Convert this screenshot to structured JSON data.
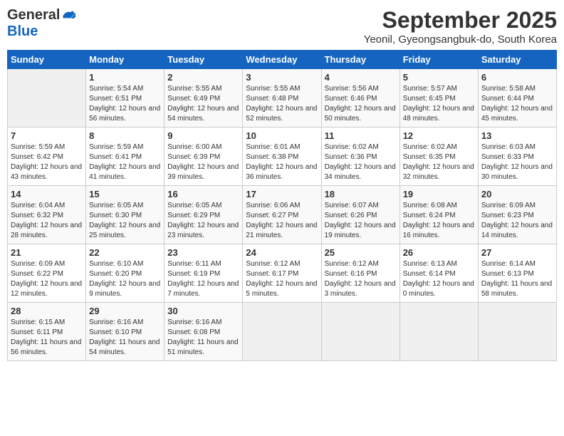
{
  "logo": {
    "general": "General",
    "blue": "Blue"
  },
  "title": "September 2025",
  "subtitle": "Yeonil, Gyeongsangbuk-do, South Korea",
  "days_of_week": [
    "Sunday",
    "Monday",
    "Tuesday",
    "Wednesday",
    "Thursday",
    "Friday",
    "Saturday"
  ],
  "weeks": [
    [
      {
        "day": "",
        "sunrise": "",
        "sunset": "",
        "daylight": ""
      },
      {
        "day": "1",
        "sunrise": "Sunrise: 5:54 AM",
        "sunset": "Sunset: 6:51 PM",
        "daylight": "Daylight: 12 hours and 56 minutes."
      },
      {
        "day": "2",
        "sunrise": "Sunrise: 5:55 AM",
        "sunset": "Sunset: 6:49 PM",
        "daylight": "Daylight: 12 hours and 54 minutes."
      },
      {
        "day": "3",
        "sunrise": "Sunrise: 5:55 AM",
        "sunset": "Sunset: 6:48 PM",
        "daylight": "Daylight: 12 hours and 52 minutes."
      },
      {
        "day": "4",
        "sunrise": "Sunrise: 5:56 AM",
        "sunset": "Sunset: 6:46 PM",
        "daylight": "Daylight: 12 hours and 50 minutes."
      },
      {
        "day": "5",
        "sunrise": "Sunrise: 5:57 AM",
        "sunset": "Sunset: 6:45 PM",
        "daylight": "Daylight: 12 hours and 48 minutes."
      },
      {
        "day": "6",
        "sunrise": "Sunrise: 5:58 AM",
        "sunset": "Sunset: 6:44 PM",
        "daylight": "Daylight: 12 hours and 45 minutes."
      }
    ],
    [
      {
        "day": "7",
        "sunrise": "Sunrise: 5:59 AM",
        "sunset": "Sunset: 6:42 PM",
        "daylight": "Daylight: 12 hours and 43 minutes."
      },
      {
        "day": "8",
        "sunrise": "Sunrise: 5:59 AM",
        "sunset": "Sunset: 6:41 PM",
        "daylight": "Daylight: 12 hours and 41 minutes."
      },
      {
        "day": "9",
        "sunrise": "Sunrise: 6:00 AM",
        "sunset": "Sunset: 6:39 PM",
        "daylight": "Daylight: 12 hours and 39 minutes."
      },
      {
        "day": "10",
        "sunrise": "Sunrise: 6:01 AM",
        "sunset": "Sunset: 6:38 PM",
        "daylight": "Daylight: 12 hours and 36 minutes."
      },
      {
        "day": "11",
        "sunrise": "Sunrise: 6:02 AM",
        "sunset": "Sunset: 6:36 PM",
        "daylight": "Daylight: 12 hours and 34 minutes."
      },
      {
        "day": "12",
        "sunrise": "Sunrise: 6:02 AM",
        "sunset": "Sunset: 6:35 PM",
        "daylight": "Daylight: 12 hours and 32 minutes."
      },
      {
        "day": "13",
        "sunrise": "Sunrise: 6:03 AM",
        "sunset": "Sunset: 6:33 PM",
        "daylight": "Daylight: 12 hours and 30 minutes."
      }
    ],
    [
      {
        "day": "14",
        "sunrise": "Sunrise: 6:04 AM",
        "sunset": "Sunset: 6:32 PM",
        "daylight": "Daylight: 12 hours and 28 minutes."
      },
      {
        "day": "15",
        "sunrise": "Sunrise: 6:05 AM",
        "sunset": "Sunset: 6:30 PM",
        "daylight": "Daylight: 12 hours and 25 minutes."
      },
      {
        "day": "16",
        "sunrise": "Sunrise: 6:05 AM",
        "sunset": "Sunset: 6:29 PM",
        "daylight": "Daylight: 12 hours and 23 minutes."
      },
      {
        "day": "17",
        "sunrise": "Sunrise: 6:06 AM",
        "sunset": "Sunset: 6:27 PM",
        "daylight": "Daylight: 12 hours and 21 minutes."
      },
      {
        "day": "18",
        "sunrise": "Sunrise: 6:07 AM",
        "sunset": "Sunset: 6:26 PM",
        "daylight": "Daylight: 12 hours and 19 minutes."
      },
      {
        "day": "19",
        "sunrise": "Sunrise: 6:08 AM",
        "sunset": "Sunset: 6:24 PM",
        "daylight": "Daylight: 12 hours and 16 minutes."
      },
      {
        "day": "20",
        "sunrise": "Sunrise: 6:09 AM",
        "sunset": "Sunset: 6:23 PM",
        "daylight": "Daylight: 12 hours and 14 minutes."
      }
    ],
    [
      {
        "day": "21",
        "sunrise": "Sunrise: 6:09 AM",
        "sunset": "Sunset: 6:22 PM",
        "daylight": "Daylight: 12 hours and 12 minutes."
      },
      {
        "day": "22",
        "sunrise": "Sunrise: 6:10 AM",
        "sunset": "Sunset: 6:20 PM",
        "daylight": "Daylight: 12 hours and 9 minutes."
      },
      {
        "day": "23",
        "sunrise": "Sunrise: 6:11 AM",
        "sunset": "Sunset: 6:19 PM",
        "daylight": "Daylight: 12 hours and 7 minutes."
      },
      {
        "day": "24",
        "sunrise": "Sunrise: 6:12 AM",
        "sunset": "Sunset: 6:17 PM",
        "daylight": "Daylight: 12 hours and 5 minutes."
      },
      {
        "day": "25",
        "sunrise": "Sunrise: 6:12 AM",
        "sunset": "Sunset: 6:16 PM",
        "daylight": "Daylight: 12 hours and 3 minutes."
      },
      {
        "day": "26",
        "sunrise": "Sunrise: 6:13 AM",
        "sunset": "Sunset: 6:14 PM",
        "daylight": "Daylight: 12 hours and 0 minutes."
      },
      {
        "day": "27",
        "sunrise": "Sunrise: 6:14 AM",
        "sunset": "Sunset: 6:13 PM",
        "daylight": "Daylight: 11 hours and 58 minutes."
      }
    ],
    [
      {
        "day": "28",
        "sunrise": "Sunrise: 6:15 AM",
        "sunset": "Sunset: 6:11 PM",
        "daylight": "Daylight: 11 hours and 56 minutes."
      },
      {
        "day": "29",
        "sunrise": "Sunrise: 6:16 AM",
        "sunset": "Sunset: 6:10 PM",
        "daylight": "Daylight: 11 hours and 54 minutes."
      },
      {
        "day": "30",
        "sunrise": "Sunrise: 6:16 AM",
        "sunset": "Sunset: 6:08 PM",
        "daylight": "Daylight: 11 hours and 51 minutes."
      },
      {
        "day": "",
        "sunrise": "",
        "sunset": "",
        "daylight": ""
      },
      {
        "day": "",
        "sunrise": "",
        "sunset": "",
        "daylight": ""
      },
      {
        "day": "",
        "sunrise": "",
        "sunset": "",
        "daylight": ""
      },
      {
        "day": "",
        "sunrise": "",
        "sunset": "",
        "daylight": ""
      }
    ]
  ]
}
